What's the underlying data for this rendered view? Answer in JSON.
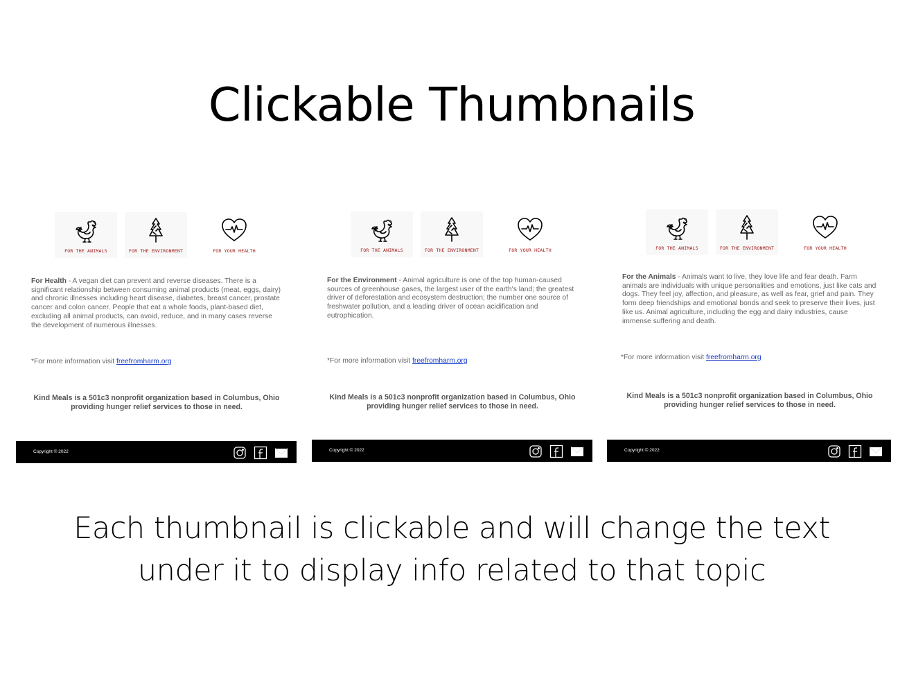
{
  "title": "Clickable Thumbnails",
  "caption_line1": "Each thumbnail is clickable and will change the text",
  "caption_line2": "under it to display info related to that topic",
  "thumbnails": [
    {
      "label": "FOR THE ANIMALS",
      "icon": "chicken-icon"
    },
    {
      "label": "FOR THE ENVIRONMENT",
      "icon": "tree-icon"
    },
    {
      "label": "FOR YOUR HEALTH",
      "icon": "heart-pulse-icon"
    }
  ],
  "mockups": [
    {
      "heading": "For Health",
      "body": " - A vegan diet can prevent and reverse diseases. There is a significant relationship between consuming animal products (meat, eggs, dairy) and chronic illnesses including heart disease, diabetes, breast cancer, prostate cancer and colon cancer. People that eat a whole foods, plant-based diet, excluding all animal products, can avoid, reduce, and in many cases reverse the development of numerous illnesses."
    },
    {
      "heading": "For the Environment",
      "body": " - Animal agriculture is one of the top human-caused sources of greenhouse gases, the largest user of the earth's land; the greatest driver of deforestation and ecosystem destruction; the number one source of freshwater pollution, and a leading driver of ocean acidification and eutrophication."
    },
    {
      "heading": "For the Animals",
      "body": " - Animals want to live, they love life and fear death. Farm animals are individuals with unique personalities and emotions, just like cats and dogs. They feel joy, affection, and pleasure, as well as fear, grief and pain. They form deep friendships and emotional bonds and seek to preserve their lives, just like us. Animal agriculture, including the egg and dairy industries, cause immense suffering and death."
    }
  ],
  "more_info_prefix": "*For more information visit ",
  "more_info_link": "freefromharm.org",
  "org_line1": "Kind Meals is a 501c3 nonprofit organization based in Columbus, Ohio",
  "org_line2": "providing hunger relief services to those in need.",
  "copyright": "Copyright © 2022",
  "social": [
    "instagram-icon",
    "facebook-icon",
    "email-icon"
  ],
  "colors": {
    "label_red": "#a11515",
    "link_blue": "#1a3ec8",
    "footer_bg": "#000000"
  }
}
